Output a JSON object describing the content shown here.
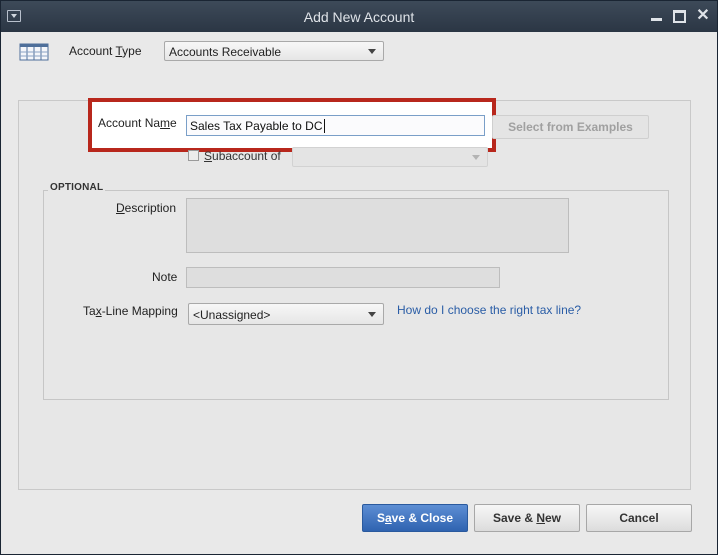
{
  "window": {
    "title": "Add New Account"
  },
  "account_type": {
    "label_pre": "Account ",
    "label_u": "T",
    "label_post": "ype",
    "value": "Accounts Receivable"
  },
  "account_name": {
    "label_pre": "Account Na",
    "label_u": "m",
    "label_post": "e",
    "value": "Sales Tax Payable to DC"
  },
  "select_examples_label": "Select from Examples",
  "subaccount": {
    "label_u": "S",
    "label_post": "ubaccount of",
    "value": ""
  },
  "optional": {
    "title": "OPTIONAL",
    "description_label_u": "D",
    "description_label_post": "escription",
    "description_value": "",
    "note_label": "Note",
    "note_value": "",
    "tax_line_label_pre": "Ta",
    "tax_line_label_u": "x",
    "tax_line_label_post": "-Line Mapping",
    "tax_line_value": "<Unassigned>",
    "tax_line_help": "How do I choose the right tax line?"
  },
  "buttons": {
    "save_close_pre": "S",
    "save_close_u": "a",
    "save_close_post": "ve & Close",
    "save_new_pre": "Save & ",
    "save_new_u": "N",
    "save_new_post": "ew",
    "cancel": "Cancel"
  },
  "icons": [
    "window-menu-icon",
    "minimize-icon",
    "maximize-icon",
    "close-icon",
    "account-register-icon",
    "dropdown-arrow-icon"
  ],
  "colors": {
    "titlebar": "#2b3644",
    "highlight_border": "#b8271c",
    "primary_button": "#2f63b0",
    "link": "#2a5da6"
  }
}
